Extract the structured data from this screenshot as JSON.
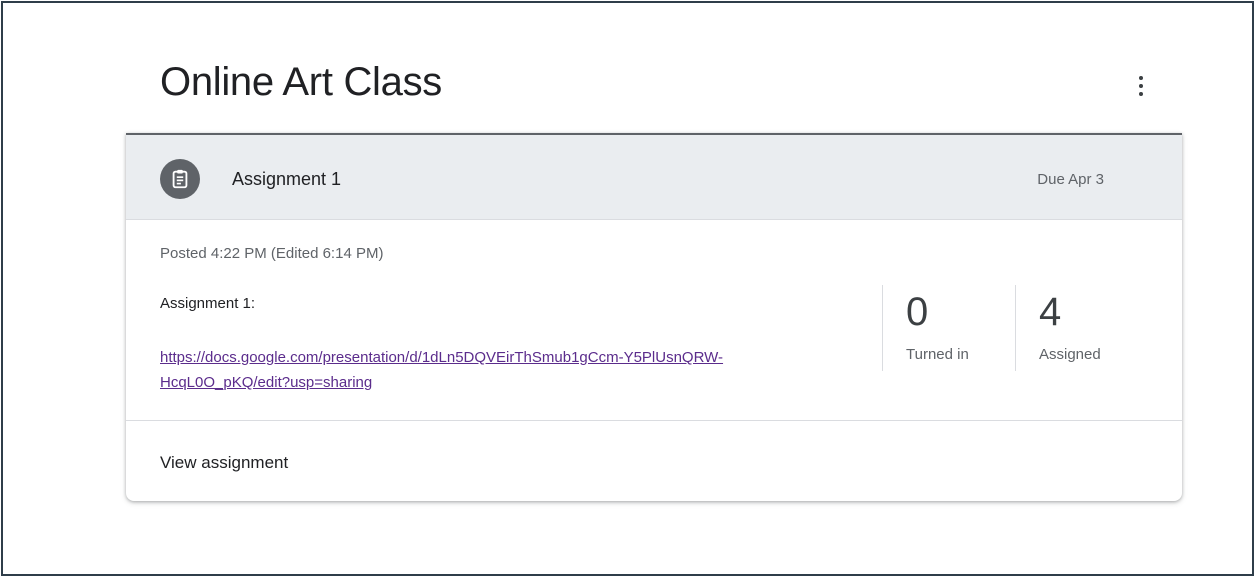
{
  "page": {
    "class_title": "Online Art Class"
  },
  "header_actions": {
    "more_icon": "more-vert-icon"
  },
  "assignment": {
    "icon": "assignment-icon",
    "title": "Assignment 1",
    "due": "Due Apr 3",
    "posted": "Posted 4:22 PM (Edited 6:14 PM)",
    "description_label": "Assignment 1:",
    "link_line1": "https://docs.google.com/presentation/d/1dLn5DQVEirThSmub1gCcm-Y5PlUsnQRW-",
    "link_line2": "HcqL0O_pKQ/edit?usp=sharing",
    "stats": [
      {
        "value": "0",
        "label": "Turned in"
      },
      {
        "value": "4",
        "label": "Assigned"
      }
    ],
    "view_label": "View assignment"
  },
  "colors": {
    "header_bg": "#eaedf0",
    "link": "#5b2c8c",
    "icon_bg": "#5f6368"
  }
}
